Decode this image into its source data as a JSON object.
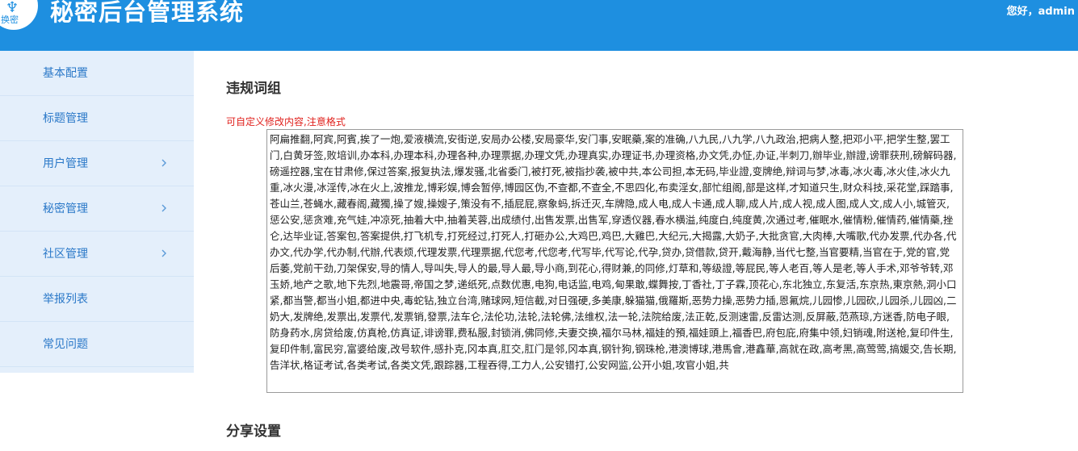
{
  "header": {
    "logo_glyph": "♆",
    "logo_text": "换密",
    "title": "秘密后台管理系统",
    "greeting": "您好，admin"
  },
  "sidebar": {
    "items": [
      {
        "label": "基本配置",
        "has_children": false
      },
      {
        "label": "标题管理",
        "has_children": false
      },
      {
        "label": "用户管理",
        "has_children": true
      },
      {
        "label": "秘密管理",
        "has_children": true
      },
      {
        "label": "社区管理",
        "has_children": true
      },
      {
        "label": "举报列表",
        "has_children": false
      },
      {
        "label": "常见问题",
        "has_children": false
      }
    ]
  },
  "main": {
    "section1_title": "违规词组",
    "hint": "可自定义修改内容,注意格式",
    "words_text": "阿扁推翻,阿宾,阿賓,挨了一炮,爱液横流,安街逆,安局办公楼,安局豪华,安门事,安眠藥,案的准确,八九民,八九学,八九政治,把病人整,把邓小平,把学生整,罢工门,白黄牙签,败培训,办本科,办理本科,办理各种,办理票据,办理文凭,办理真实,办理证书,办理资格,办文凭,办怔,办证,半刺刀,辦毕业,辦證,谤罪获刑,磅解码器,磅遥控器,宝在甘肃修,保过答案,报复执法,爆发骚,北省委门,被打死,被指抄袭,被中共,本公司担,本无码,毕业證,变牌绝,辩词与梦,冰毒,冰火毒,冰火佳,冰火九重,冰火漫,冰淫传,冰在火上,波推龙,博彩娱,博会暂停,博园区伪,不查都,不查全,不思四化,布卖淫女,部忙组阁,部是这样,才知道只生,财众科技,采花堂,踩踏事,苍山兰,苍蝇水,藏春阁,藏獨,操了嫂,操嫂子,策没有不,插屁屁,察象蚂,拆迁灭,车牌隐,成人电,成人卡通,成人聊,成人片,成人视,成人图,成人文,成人小,城管灭,惩公安,惩贪难,充气娃,冲凉死,抽着大中,抽着芙蓉,出成绩付,出售发票,出售军,穿透仪器,春水横溢,纯度白,纯度黄,次通过考,催眠水,催情粉,催情药,催情藥,挫仑,达毕业证,答案包,答案提供,打飞机专,打死经过,打死人,打砸办公,大鸡巴,鸡巴,大雞巴,大纪元,大揭露,大奶子,大批贪官,大肉棒,大嘴歌,代办发票,代办各,代办文,代办学,代办制,代辦,代表烦,代理发票,代理票据,代您考,代您考,代写毕,代写论,代孕,贷办,贷借款,贷开,戴海静,当代七整,当官要精,当官在于,党的官,党后萎,党前干劲,刀架保安,导的情人,导叫失,导人的最,导人最,导小商,到花心,得财兼,的同修,灯草和,等级證,等屁民,等人老百,等人是老,等人手术,邓爷爷转,邓玉娇,地产之歌,地下先烈,地震哥,帝国之梦,递纸死,点数优惠,电狗,电话监,电鸡,甸果敢,蝶舞按,丁香社,丁子霖,顶花心,东北独立,东复活,东京热,東京熱,洞小口紧,都当警,都当小姐,都进中央,毒蛇钻,独立台湾,赌球网,短信截,对日强硬,多美康,躲猫猫,俄羅斯,恶势力操,恶势力插,恩氟烷,儿园惨,儿园砍,儿园杀,儿园凶,二奶大,发牌绝,发票出,发票代,发票销,發票,法车仑,法伦功,法轮,法轮佛,法维权,法一轮,法院给废,法正乾,反测速雷,反雷达测,反屏蔽,范燕琼,方迷香,防电子眼,防身药水,房贷给废,仿真枪,仿真证,诽谤罪,费私服,封锁消,佛同修,夫妻交换,福尔马林,福娃的預,福娃頭上,福香巴,府包庇,府集中领,妇销魂,附送枪,复印件生,复印件制,富民穷,富婆给废,改号软件,感扑克,冈本真,肛交,肛门是邻,冈本真,钢针狗,钢珠枪,港澳博球,港馬會,港鑫華,高就在政,高考黑,高莺莺,搞媛交,告长期,告洋状,格证考试,各类考试,各类文凭,跟踪器,工程吞得,工力人,公安错打,公安网监,公开小姐,攻官小姐,共"
  },
  "section2_title": "分享设置"
}
